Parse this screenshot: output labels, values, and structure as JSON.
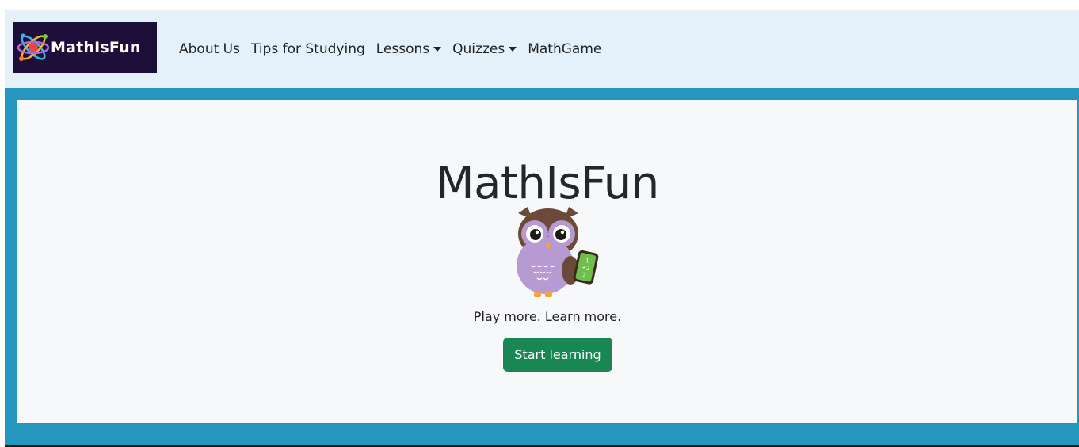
{
  "navbar": {
    "brand": {
      "label": "MathIsFun",
      "icon": "atom-logo-icon"
    },
    "links": [
      {
        "label": "About Us",
        "dropdown": false
      },
      {
        "label": "Tips for Studying",
        "dropdown": false
      },
      {
        "label": "Lessons",
        "dropdown": true
      },
      {
        "label": "Quizzes",
        "dropdown": true
      },
      {
        "label": "MathGame",
        "dropdown": false
      }
    ]
  },
  "hero": {
    "title": "MathIsFun",
    "mascot": "owl-with-tablet-icon",
    "tagline": "Play more. Learn more.",
    "cta_label": "Start learning"
  },
  "colors": {
    "navbar_bg": "#e4f1fb",
    "brand_bg": "#1d0f3a",
    "frame": "#2596be",
    "hero_bg": "#f7f8fa",
    "cta": "#198754"
  }
}
